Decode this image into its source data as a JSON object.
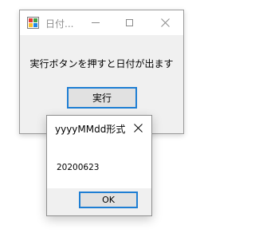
{
  "main_window": {
    "title": "日付...",
    "icon": "winforms-app-icon",
    "controls": {
      "minimize_icon": "minimize-icon",
      "maximize_icon": "maximize-icon",
      "close_icon": "close-icon"
    },
    "label": "実行ボタンを押すと日付が出ます",
    "run_button_label": "実行",
    "accent_color": "#1e7ed3"
  },
  "message_box": {
    "title": "yyyyMMdd形式",
    "message": "20200623",
    "ok_button_label": "OK",
    "close_icon": "close-icon"
  }
}
